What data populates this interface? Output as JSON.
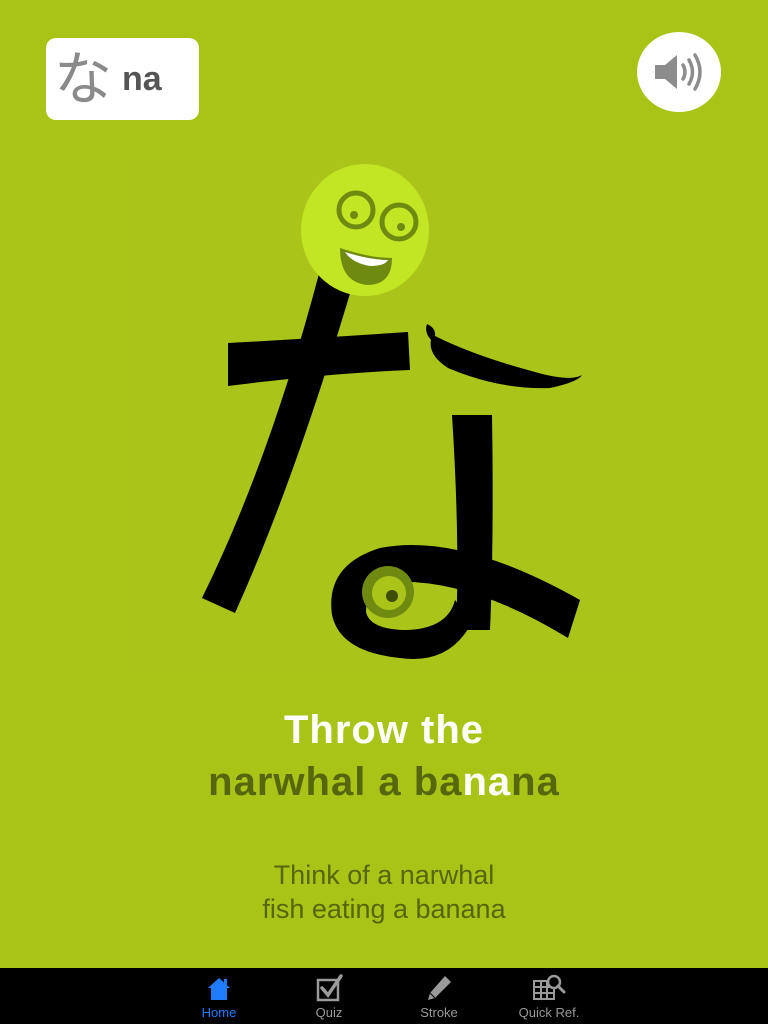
{
  "kana": {
    "glyph": "な",
    "romaji": "na"
  },
  "mnemonic": {
    "line1": "Throw the",
    "line2_parts": [
      {
        "text": "narwhal a ba",
        "tone": "dark"
      },
      {
        "text": "na",
        "tone": "white"
      },
      {
        "text": "na",
        "tone": "dark"
      }
    ]
  },
  "hint": {
    "line1": "Think of a narwhal",
    "line2": "fish eating a banana"
  },
  "tabs": [
    {
      "label": "Home",
      "icon": "home-icon",
      "active": true
    },
    {
      "label": "Quiz",
      "icon": "checkbox-icon",
      "active": false
    },
    {
      "label": "Stroke",
      "icon": "pencil-icon",
      "active": false
    },
    {
      "label": "Quick Ref.",
      "icon": "grid-search-icon",
      "active": false
    }
  ],
  "colors": {
    "background": "#a9c417",
    "face": "#c3e624",
    "stroke": "#000000",
    "tab_active": "#1f7cff",
    "tab_inactive": "#9a9a9a"
  }
}
